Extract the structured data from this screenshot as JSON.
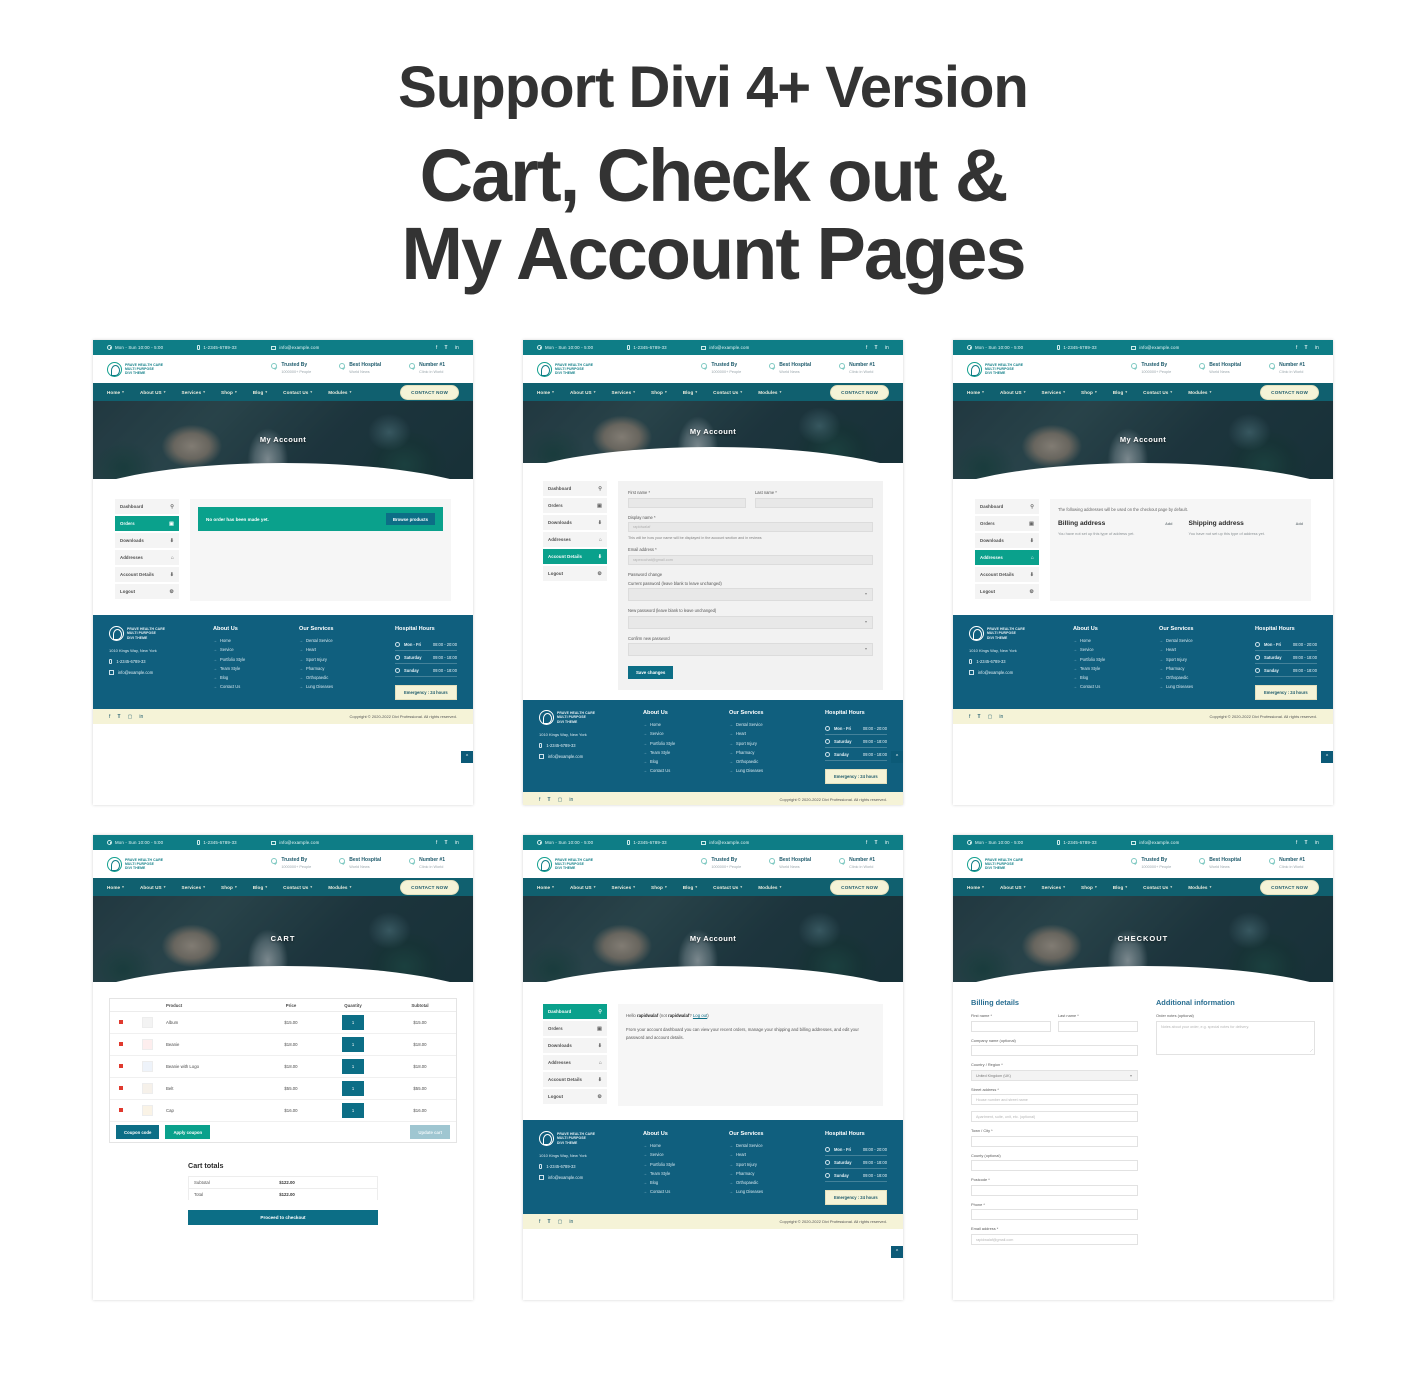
{
  "poster": {
    "line1": "Support Divi 4+ Version",
    "line2": "Cart, Check out &",
    "line3": "My Account Pages"
  },
  "site": {
    "topbar": {
      "hours": "Mon - Sun 10:00 - 5:00",
      "phone": "1-2345-6789-33",
      "email": "info@example.com",
      "social": [
        "f",
        "ƒ",
        "in"
      ]
    },
    "logo": {
      "line1": "PRAVE HEALTH CARE",
      "line2": "MULTI PURPOSE",
      "line3": "DIVI THEME"
    },
    "badges": [
      {
        "title": "Trusted By",
        "sub": "1000000+ People"
      },
      {
        "title": "Best Hospital",
        "sub": "World News"
      },
      {
        "title": "Number #1",
        "sub": "Clinic in World"
      }
    ],
    "nav": {
      "items": [
        "Home",
        "About US",
        "Services",
        "Shop",
        "Blog",
        "Contact Us",
        "Modules"
      ],
      "cta": "CONTACT NOW"
    },
    "footer": {
      "address": "1010 Kings Way, New York",
      "phone": "1-2345-6789-33",
      "email": "info@example.com",
      "about_title": "About Us",
      "about_links": [
        "Home",
        "Service",
        "Portfolio Style",
        "Team Style",
        "Blog",
        "Contact Us"
      ],
      "services_title": "Our Services",
      "services_links": [
        "Dental Service",
        "Heart",
        "Sport Injury",
        "Pharmacy",
        "Orthopaedic",
        "Lung Diseases"
      ],
      "hours_title": "Hospital Hours",
      "hours": [
        {
          "day": "Mon - Fri",
          "time": "08:00 - 20:00"
        },
        {
          "day": "Saturday",
          "time": "09:00 - 18:00"
        },
        {
          "day": "Sunday",
          "time": "09:00 - 18:00"
        }
      ],
      "emergency": "Emergency : 24 hours",
      "copyright": "Copyright © 2020-2022 Divi Professional. All rights reserved."
    }
  },
  "account_nav": [
    {
      "label": "Dashboard",
      "icon": "⌕"
    },
    {
      "label": "Orders",
      "icon": "▤"
    },
    {
      "label": "Downloads",
      "icon": "⬇"
    },
    {
      "label": "Addresses",
      "icon": "⌂"
    },
    {
      "label": "Account Details",
      "icon": "⬇"
    },
    {
      "label": "Logout",
      "icon": "⚙"
    }
  ],
  "screens": {
    "orders": {
      "hero_title": "My Account",
      "active_nav": "Orders",
      "notice": "No order has been made yet.",
      "notice_button": "Browse products"
    },
    "account_details": {
      "hero_title": "My Account",
      "active_nav": "Account Details",
      "fields": {
        "first_name_label": "First name *",
        "first_name_value": "",
        "last_name_label": "Last name *",
        "last_name_value": "",
        "display_name_label": "Display name *",
        "display_name_value": "rapidwalaf",
        "display_name_hint": "This will be how your name will be displayed in the account section and in reviews",
        "email_label": "Email address *",
        "email_value": "rapexochat@gmail.com",
        "password_section": "Password change",
        "current_password_label": "Current password (leave blank to leave unchanged)",
        "new_password_label": "New password (leave blank to leave unchanged)",
        "confirm_password_label": "Confirm new password",
        "save_button": "Save changes"
      }
    },
    "addresses": {
      "hero_title": "My Account",
      "active_nav": "Addresses",
      "lead": "The following addresses will be used on the checkout page by default.",
      "billing_title": "Billing address",
      "billing_add": "Add",
      "billing_empty": "You have not set up this type of address yet.",
      "shipping_title": "Shipping address",
      "shipping_add": "Add",
      "shipping_empty": "You have not set up this type of address yet."
    },
    "cart": {
      "hero_title": "CART",
      "columns": [
        "Product",
        "Price",
        "Quantity",
        "Subtotal"
      ],
      "rows": [
        {
          "name": "Album",
          "price": "$15.00",
          "qty": "1",
          "subtotal": "$15.00"
        },
        {
          "name": "Beanie",
          "price": "$18.00",
          "qty": "1",
          "subtotal": "$18.00"
        },
        {
          "name": "Beanie with Logo",
          "price": "$18.00",
          "qty": "1",
          "subtotal": "$18.00"
        },
        {
          "name": "Belt",
          "price": "$55.00",
          "qty": "1",
          "subtotal": "$55.00"
        },
        {
          "name": "Cap",
          "price": "$16.00",
          "qty": "1",
          "subtotal": "$16.00"
        }
      ],
      "coupon_placeholder": "Coupon code",
      "apply_coupon": "Apply coupon",
      "update_cart": "Update cart",
      "totals_title": "Cart totals",
      "subtotal_label": "Subtotal",
      "subtotal_value": "$122.00",
      "total_label": "Total",
      "total_value": "$122.00",
      "checkout_button": "Proceed to checkout"
    },
    "dashboard": {
      "hero_title": "My Account",
      "active_nav": "Dashboard",
      "greeting_prefix": "Hello ",
      "greeting_user": "rapidwalaf",
      "greeting_mid": " (not ",
      "greeting_user2": "rapidwalaf",
      "greeting_suffix": "? ",
      "logout_link": "Log out",
      "greeting_close": ")",
      "body": "From your account dashboard you can view your recent orders, manage your shipping and billing addresses, and edit your password and account details."
    },
    "checkout": {
      "hero_title": "CHECKOUT",
      "billing_title": "Billing details",
      "additional_title": "Additional information",
      "first_name_label": "First name *",
      "last_name_label": "Last name *",
      "company_label": "Company name (optional)",
      "country_label": "Country / Region *",
      "country_value": "United Kingdom (UK)",
      "street_label": "Street address *",
      "street_ph1": "House number and street name",
      "street_ph2": "Apartment, suite, unit, etc. (optional)",
      "town_label": "Town / City *",
      "county_label": "County (optional)",
      "postcode_label": "Postcode *",
      "phone_label": "Phone *",
      "email_label": "Email address *",
      "email_value": "rapidwalaf@gmail.com",
      "order_notes_label": "Order notes (optional)",
      "order_notes_ph": "Notes about your order, e.g. special notes for delivery."
    }
  },
  "colors": {
    "teal_top": "#0e7d86",
    "teal_accent": "#0aa18c",
    "nav_blue": "#10606f",
    "footer_blue": "#105f7e",
    "cream": "#f5f3d7",
    "dark_blue_btn": "#0c6e86"
  }
}
